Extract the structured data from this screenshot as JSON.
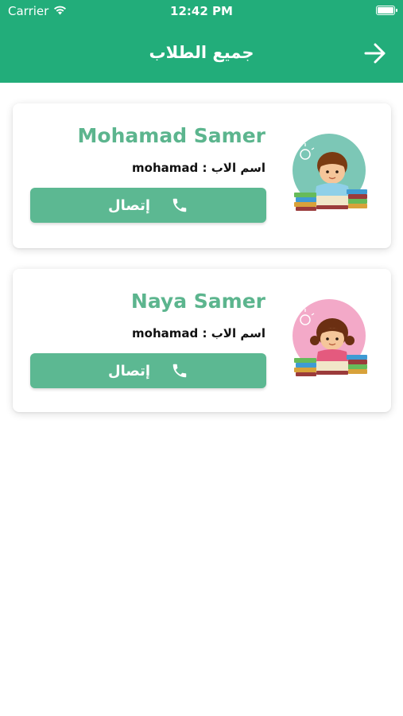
{
  "status": {
    "carrier": "Carrier",
    "time": "12:42 PM"
  },
  "header": {
    "title": "جميع الطلاب",
    "back_icon": "arrow-right-icon"
  },
  "colors": {
    "primary": "#22ad7a",
    "accent": "#5cb892",
    "name_color": "#5cb58e"
  },
  "students": [
    {
      "name": "Mohamad Samer",
      "father_label": "اسم الاب :",
      "father_name": "mohamad",
      "call_label": "إتصال",
      "avatar": "boy-reading-books-avatar"
    },
    {
      "name": "Naya Samer",
      "father_label": "اسم الاب :",
      "father_name": "mohamad",
      "call_label": "إتصال",
      "avatar": "girl-reading-books-avatar"
    }
  ]
}
